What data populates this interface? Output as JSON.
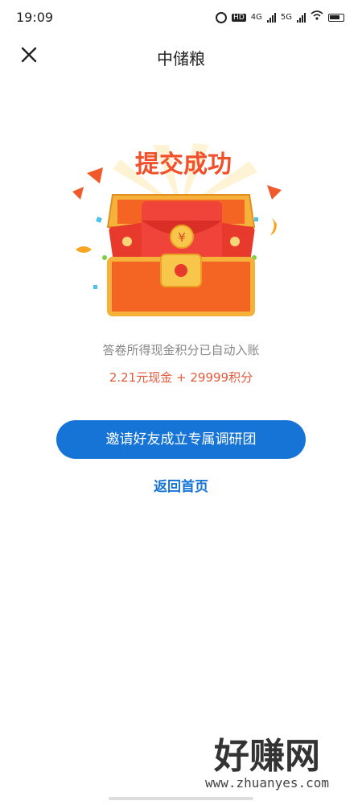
{
  "status_bar": {
    "time": "19:09"
  },
  "header": {
    "title": "中储粮",
    "close_icon": "close-icon"
  },
  "illustration": {
    "banner": "提交成功",
    "coin_symbol": "¥"
  },
  "result": {
    "description": "答卷所得现金积分已自动入账",
    "reward": "2.21元现金 + 29999积分"
  },
  "actions": {
    "invite_label": "邀请好友成立专属调研团",
    "back_label": "返回首页"
  },
  "watermark": {
    "logo_text": "好赚网",
    "url": "www.zhuanyes.com"
  },
  "colors": {
    "primary": "#1574d6",
    "reward": "#e45a3c",
    "muted": "#888888"
  }
}
